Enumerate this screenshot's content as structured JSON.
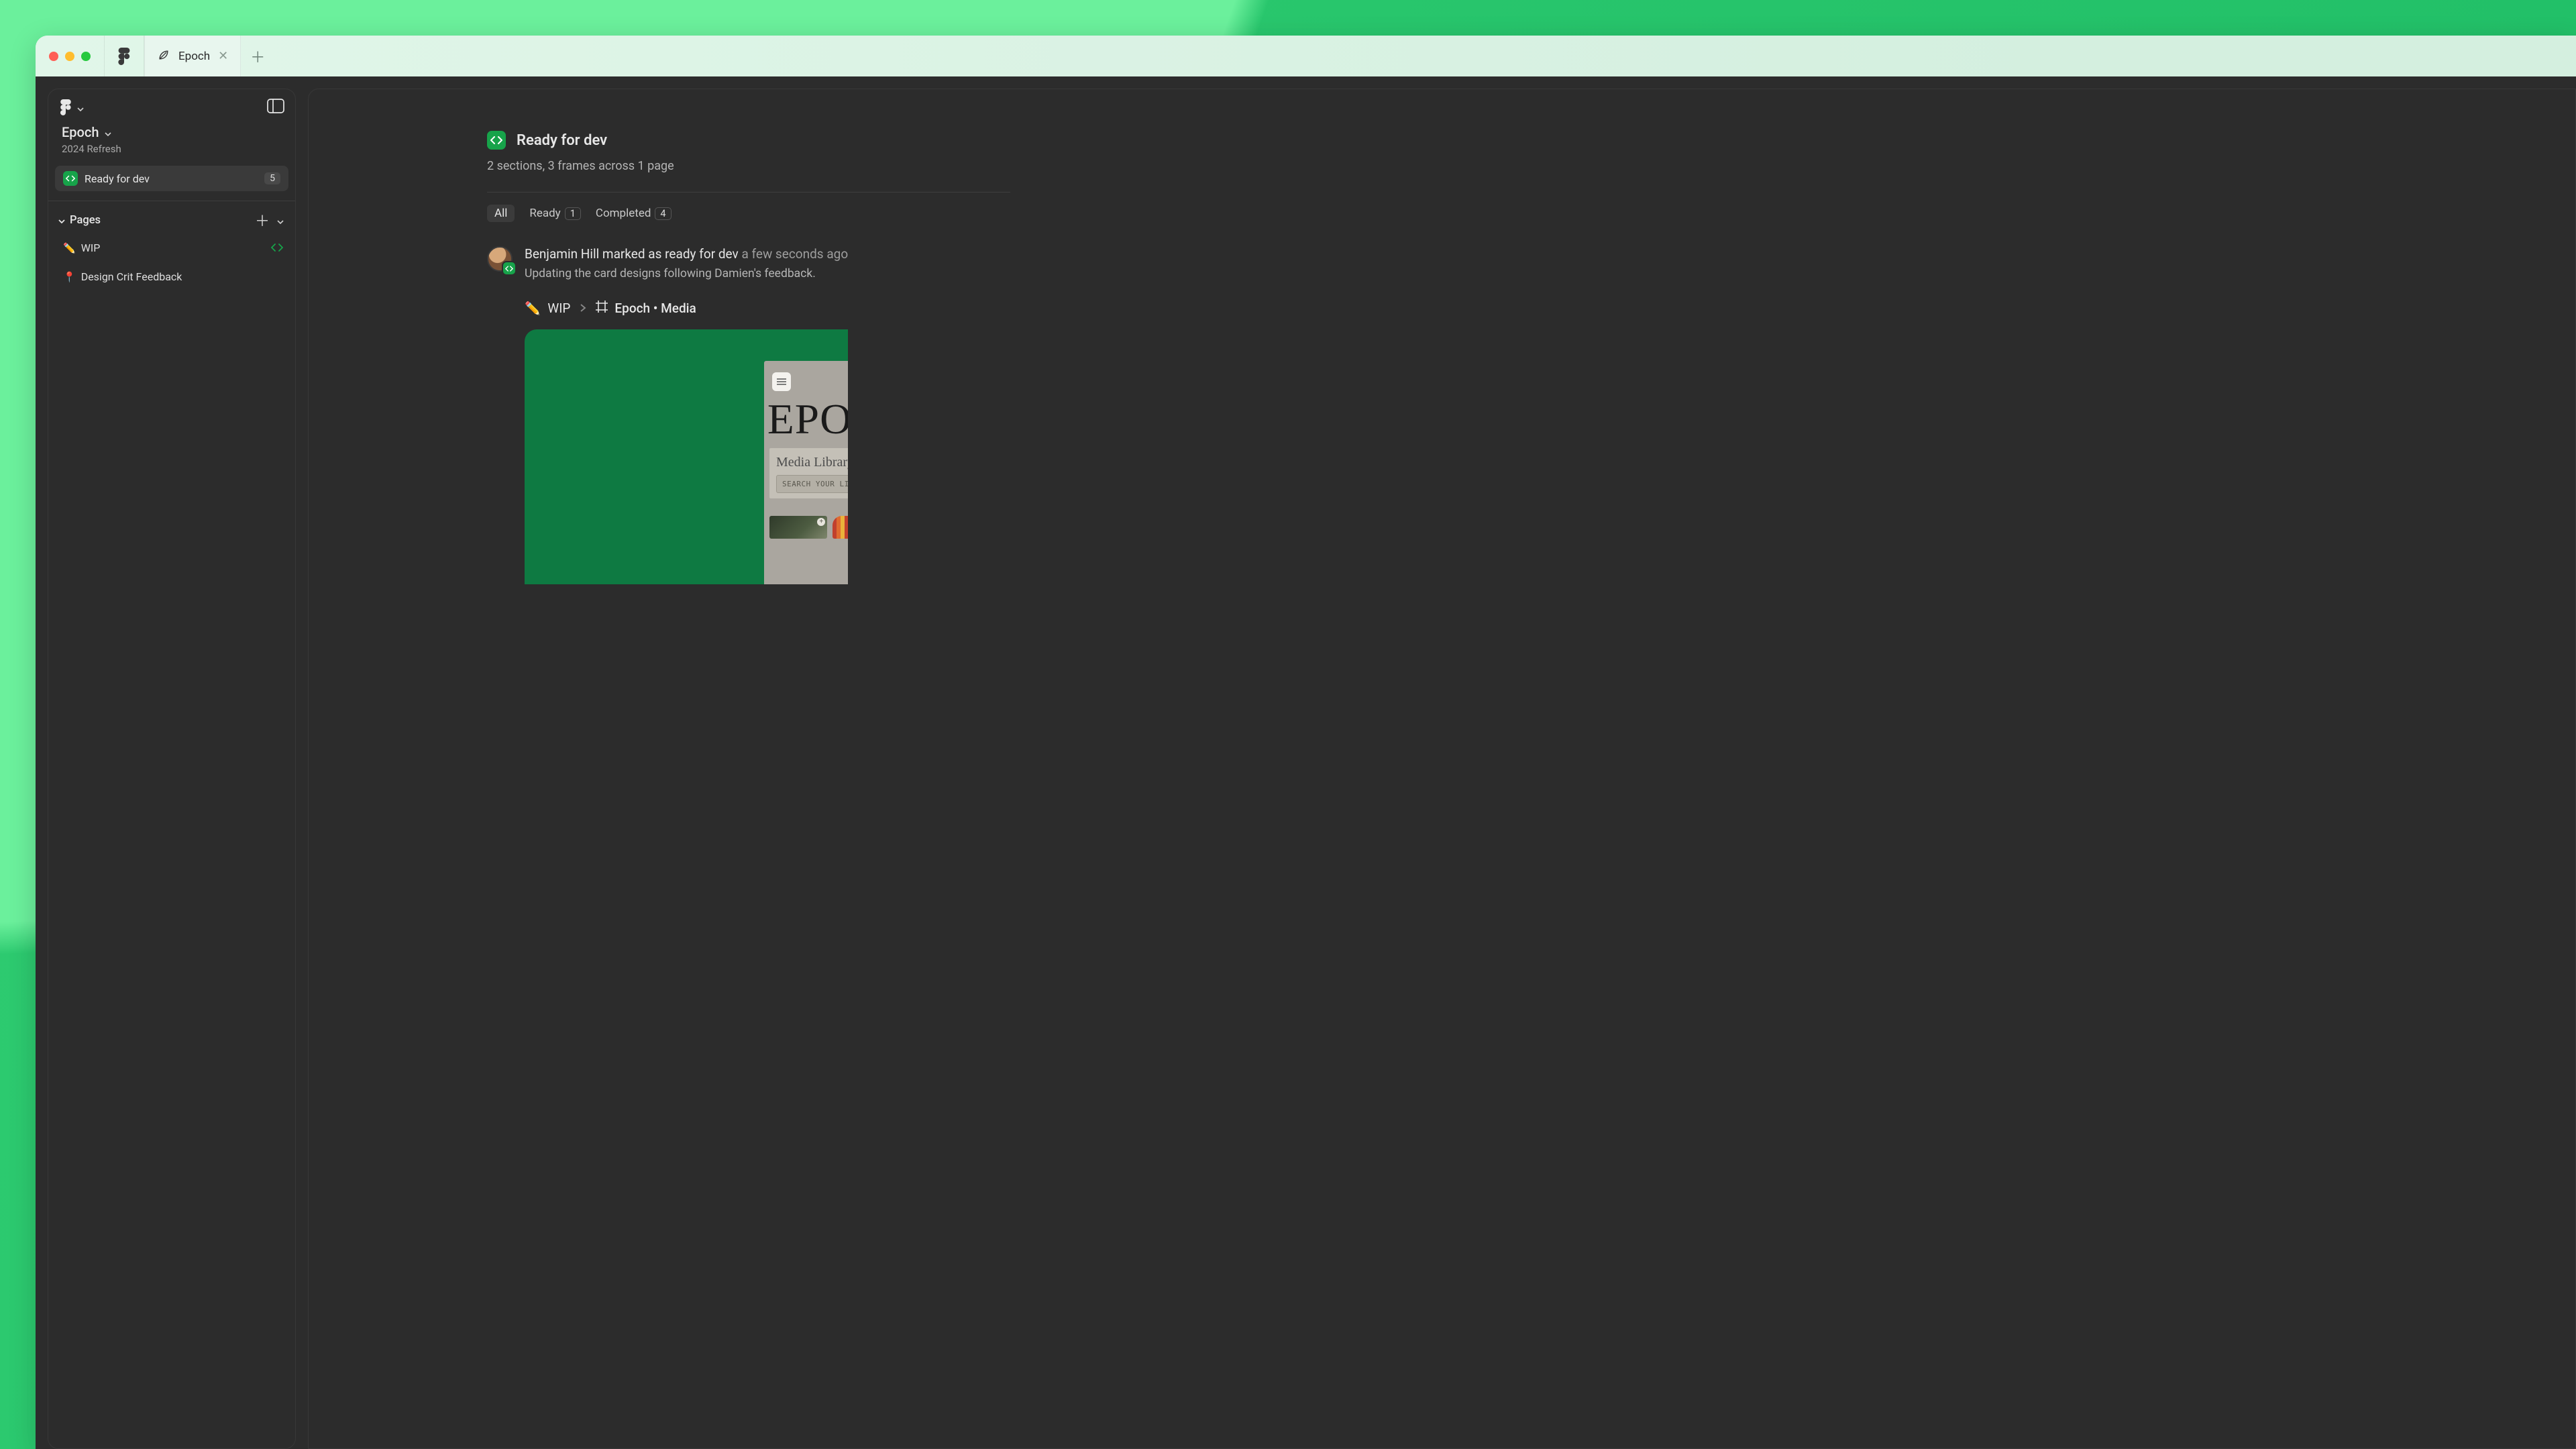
{
  "tab": {
    "name": "Epoch"
  },
  "sidebar": {
    "file_title": "Epoch",
    "file_subtitle": "2024 Refresh",
    "ready_label": "Ready for dev",
    "ready_count": "5",
    "pages_label": "Pages",
    "pages": [
      {
        "emoji": "✏️",
        "name": "WIP",
        "has_dev": true
      },
      {
        "emoji": "📍",
        "name": "Design Crit Feedback",
        "has_dev": false
      }
    ]
  },
  "main": {
    "title": "Ready for dev",
    "subtitle": "2 sections, 3 frames across 1 page",
    "filters": {
      "all": "All",
      "ready_label": "Ready",
      "ready_count": "1",
      "completed_label": "Completed",
      "completed_count": "4"
    },
    "activity": {
      "actor": "Benjamin Hill",
      "action": "marked as ready for dev",
      "time": "a few seconds ago",
      "note": "Updating the card designs following Damien's feedback."
    },
    "breadcrumb": {
      "left_emoji": "✏️",
      "left": "WIP",
      "right": "Epoch • Media"
    },
    "mock": {
      "brand": "EPOCH",
      "card_title": "Media Library",
      "search_placeholder": "SEARCH YOUR LIBRARY"
    }
  },
  "colors": {
    "dev_green": "#17a34a",
    "frame_green": "#0e7a42",
    "panel": "#2c2c2c"
  }
}
